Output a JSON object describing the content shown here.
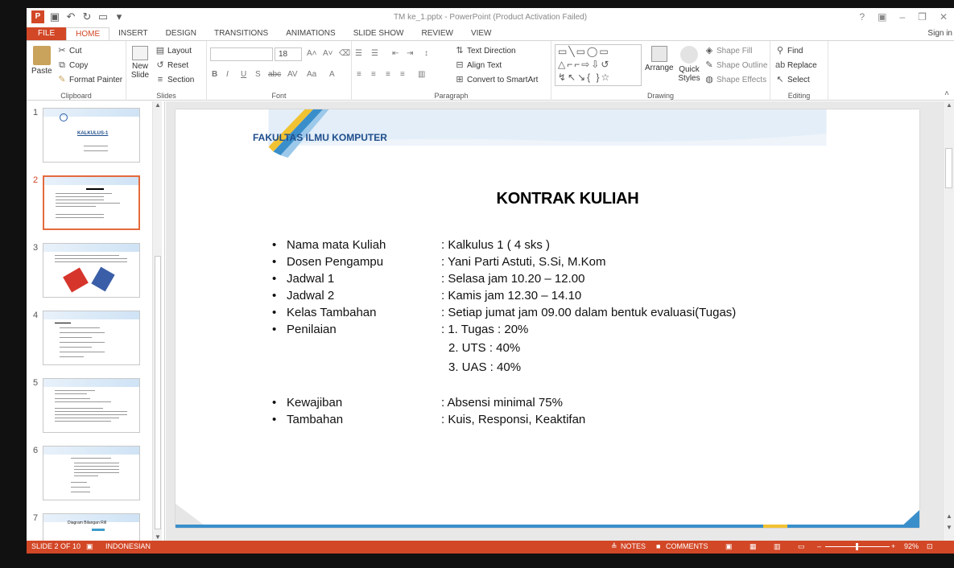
{
  "window": {
    "title": "TM ke_1.pptx - PowerPoint (Product Activation Failed)",
    "signin": "Sign in"
  },
  "tabs": [
    "FILE",
    "HOME",
    "INSERT",
    "DESIGN",
    "TRANSITIONS",
    "ANIMATIONS",
    "SLIDE SHOW",
    "REVIEW",
    "VIEW"
  ],
  "ribbon": {
    "clipboard": {
      "paste": "Paste",
      "cut": "Cut",
      "copy": "Copy",
      "format_painter": "Format Painter",
      "label": "Clipboard"
    },
    "slides": {
      "new_slide": "New Slide",
      "layout": "Layout",
      "reset": "Reset",
      "section": "Section",
      "label": "Slides"
    },
    "font": {
      "size": "18",
      "label": "Font"
    },
    "paragraph": {
      "text_direction": "Text Direction",
      "align_text": "Align Text",
      "convert": "Convert to SmartArt",
      "label": "Paragraph"
    },
    "drawing": {
      "arrange": "Arrange",
      "quick_styles": "Quick Styles",
      "shape_fill": "Shape Fill",
      "shape_outline": "Shape Outline",
      "shape_effects": "Shape Effects",
      "label": "Drawing"
    },
    "editing": {
      "find": "Find",
      "replace": "Replace",
      "select": "Select",
      "label": "Editing"
    }
  },
  "thumbnails": [
    {
      "num": "1",
      "title": "KALKULUS-1"
    },
    {
      "num": "2",
      "title": "KONTRAK KULIAH"
    },
    {
      "num": "3",
      "title": ""
    },
    {
      "num": "4",
      "title": ""
    },
    {
      "num": "5",
      "title": ""
    },
    {
      "num": "6",
      "title": ""
    },
    {
      "num": "7",
      "title": "Diagram Bilangan Rill"
    }
  ],
  "slide": {
    "header": "FAKULTAS ILMU KOMPUTER",
    "title": "KONTRAK KULIAH",
    "rows": [
      {
        "label": "Nama mata Kuliah",
        "value": ": Kalkulus 1 ( 4 sks )"
      },
      {
        "label": "Dosen Pengampu",
        "value": ": Yani Parti Astuti, S.Si, M.Kom"
      },
      {
        "label": "Jadwal 1",
        "value": ": Selasa jam 10.20 – 12.00"
      },
      {
        "label": "Jadwal 2",
        "value": ": Kamis jam 12.30 – 14.10"
      },
      {
        "label": "Kelas Tambahan",
        "value": ": Setiap jumat jam 09.00 dalam bentuk evaluasi(Tugas)"
      },
      {
        "label": "Penilaian",
        "value": ": 1. Tugas  : 20%"
      }
    ],
    "subrows": [
      "2. UTS     : 40%",
      "3. UAS     : 40%"
    ],
    "rows2": [
      {
        "label": "Kewajiban",
        "value": ": Absensi minimal 75%"
      },
      {
        "label": "Tambahan",
        "value": ": Kuis, Responsi, Keaktifan"
      }
    ]
  },
  "status": {
    "slide": "SLIDE 2 OF 10",
    "language": "INDONESIAN",
    "notes": "NOTES",
    "comments": "COMMENTS",
    "zoom": "92%"
  },
  "colors": {
    "accent": "#d24726",
    "header_text": "#1f4e8c"
  }
}
